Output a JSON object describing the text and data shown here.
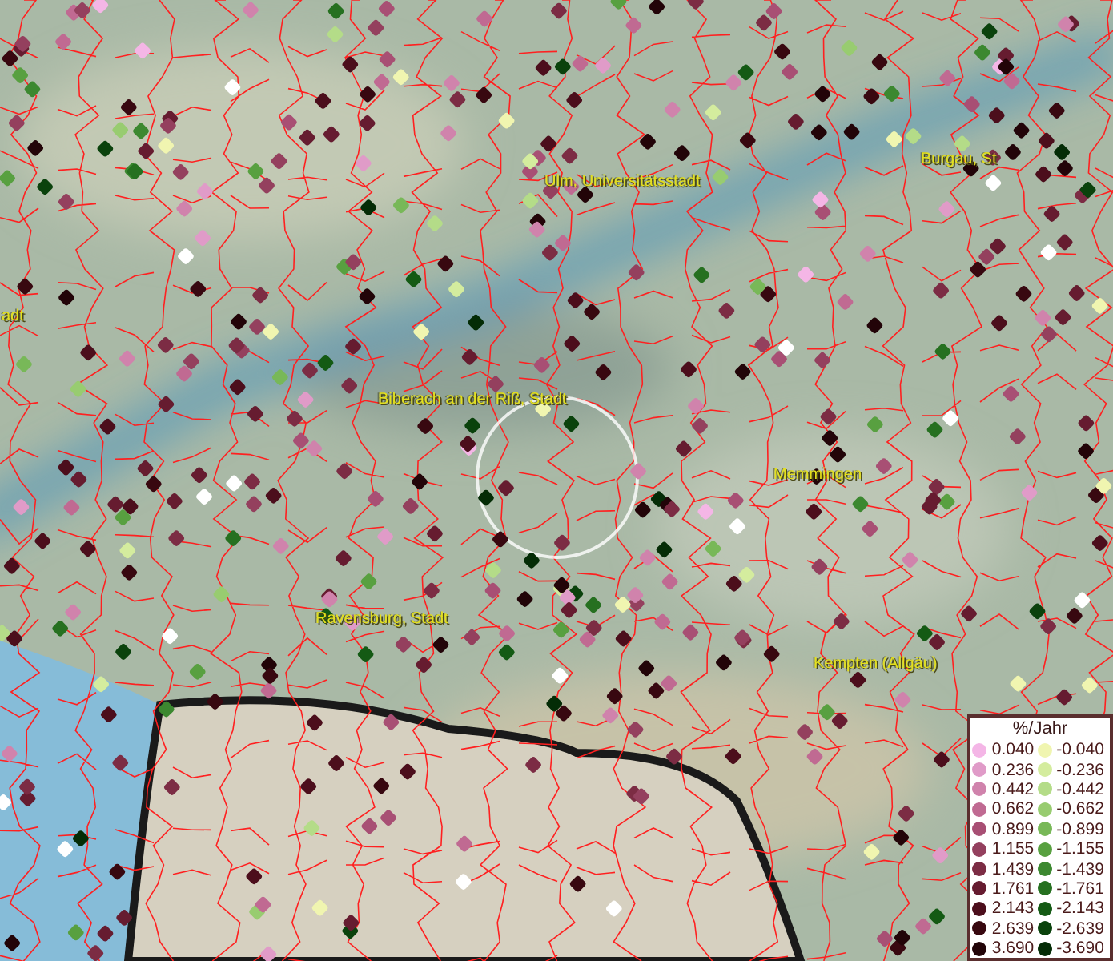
{
  "map": {
    "place_labels": [
      {
        "text": "Ulm, Universitätsstadt"
      },
      {
        "text": "Burgau, St"
      },
      {
        "text": "adt"
      },
      {
        "text": "Biberach an der Riß, Stadt"
      },
      {
        "text": "Memmingen"
      },
      {
        "text": "Ravensburg, Stadt"
      },
      {
        "text": "Kempten (Allgäu)"
      }
    ]
  },
  "legend": {
    "title": "%/Jahr",
    "positive": [
      {
        "value": "0.040",
        "color": "#f4b6e6"
      },
      {
        "value": "0.236",
        "color": "#e09bc8"
      },
      {
        "value": "0.442",
        "color": "#d083ac"
      },
      {
        "value": "0.662",
        "color": "#c06a92"
      },
      {
        "value": "0.899",
        "color": "#a84f74"
      },
      {
        "value": "1.155",
        "color": "#94405e"
      },
      {
        "value": "1.439",
        "color": "#7c2c44"
      },
      {
        "value": "1.761",
        "color": "#661c30"
      },
      {
        "value": "2.143",
        "color": "#4c0e1c"
      },
      {
        "value": "2.639",
        "color": "#380810"
      },
      {
        "value": "3.690",
        "color": "#220408"
      }
    ],
    "negative": [
      {
        "value": "-0.040",
        "color": "#f0f5b0"
      },
      {
        "value": "-0.236",
        "color": "#d4ec9e"
      },
      {
        "value": "-0.442",
        "color": "#b4dc88"
      },
      {
        "value": "-0.662",
        "color": "#98cc70"
      },
      {
        "value": "-0.899",
        "color": "#78b858"
      },
      {
        "value": "-1.155",
        "color": "#58a040"
      },
      {
        "value": "-1.439",
        "color": "#3c8830"
      },
      {
        "value": "-1.761",
        "color": "#267020"
      },
      {
        "value": "-2.143",
        "color": "#145a14"
      },
      {
        "value": "-2.639",
        "color": "#0a420c"
      },
      {
        "value": "-3.690",
        "color": "#042c06"
      }
    ]
  }
}
